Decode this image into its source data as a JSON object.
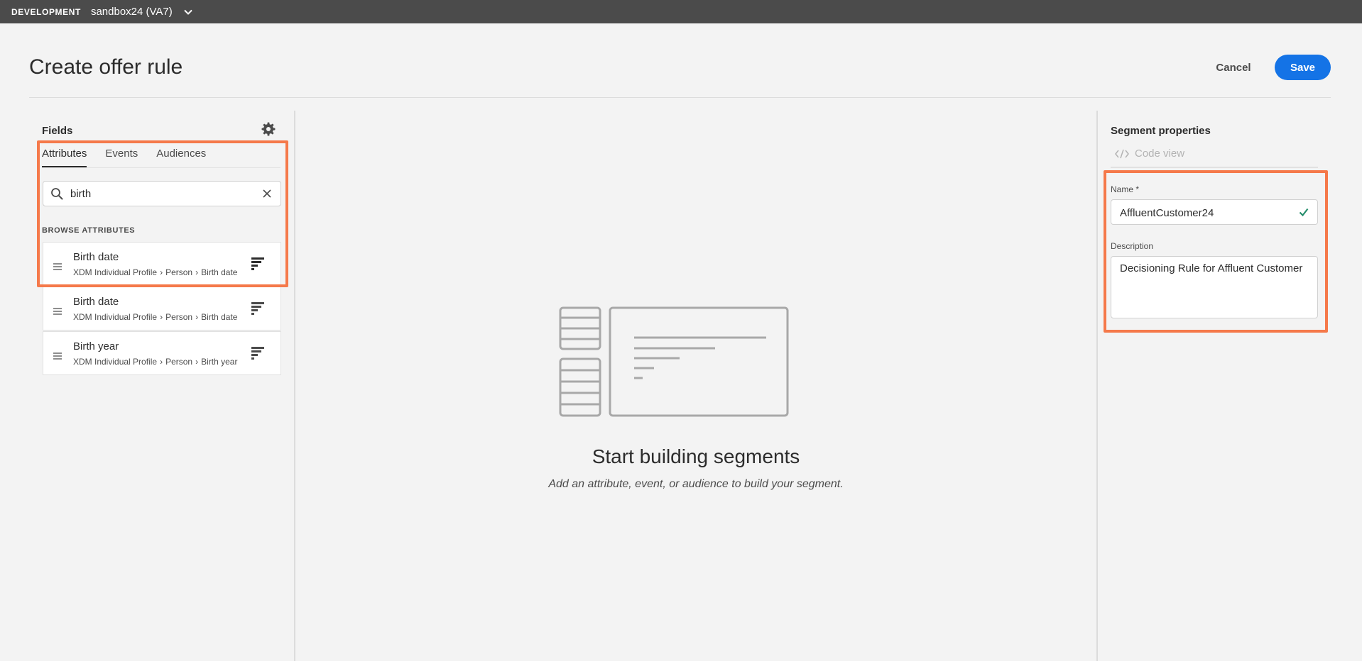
{
  "topbar": {
    "environment": "DEVELOPMENT",
    "sandbox": "sandbox24 (VA7)",
    "icons": {
      "sandbox_switch": "chevron-down-icon"
    }
  },
  "header": {
    "title": "Create offer rule",
    "cancel_label": "Cancel",
    "save_label": "Save"
  },
  "fields_panel": {
    "title": "Fields",
    "settings_icon": "gear-icon",
    "tabs": [
      {
        "label": "Attributes",
        "active": true
      },
      {
        "label": "Events",
        "active": false
      },
      {
        "label": "Audiences",
        "active": false
      }
    ],
    "search": {
      "value": "birth",
      "placeholder": ""
    },
    "browse_label": "BROWSE ATTRIBUTES",
    "attributes": [
      {
        "name": "Birth date",
        "path": [
          "XDM Individual Profile",
          "Person",
          "Birth date"
        ]
      },
      {
        "name": "Birth date",
        "path": [
          "XDM Individual Profile",
          "Person",
          "Birth date"
        ]
      },
      {
        "name": "Birth year",
        "path": [
          "XDM Individual Profile",
          "Person",
          "Birth year"
        ]
      }
    ]
  },
  "canvas": {
    "title": "Start building segments",
    "subtitle": "Add an attribute, event, or audience to build your segment."
  },
  "segment_properties": {
    "title": "Segment properties",
    "code_view_label": "Code view",
    "name_label": "Name *",
    "name_value": "AffluentCustomer24",
    "description_label": "Description",
    "description_value": "Decisioning Rule for Affluent Customer"
  },
  "colors": {
    "accent": "#1473e6",
    "highlight": "#f5794a",
    "valid": "#268e6c",
    "topbar": "#4b4b4b"
  }
}
